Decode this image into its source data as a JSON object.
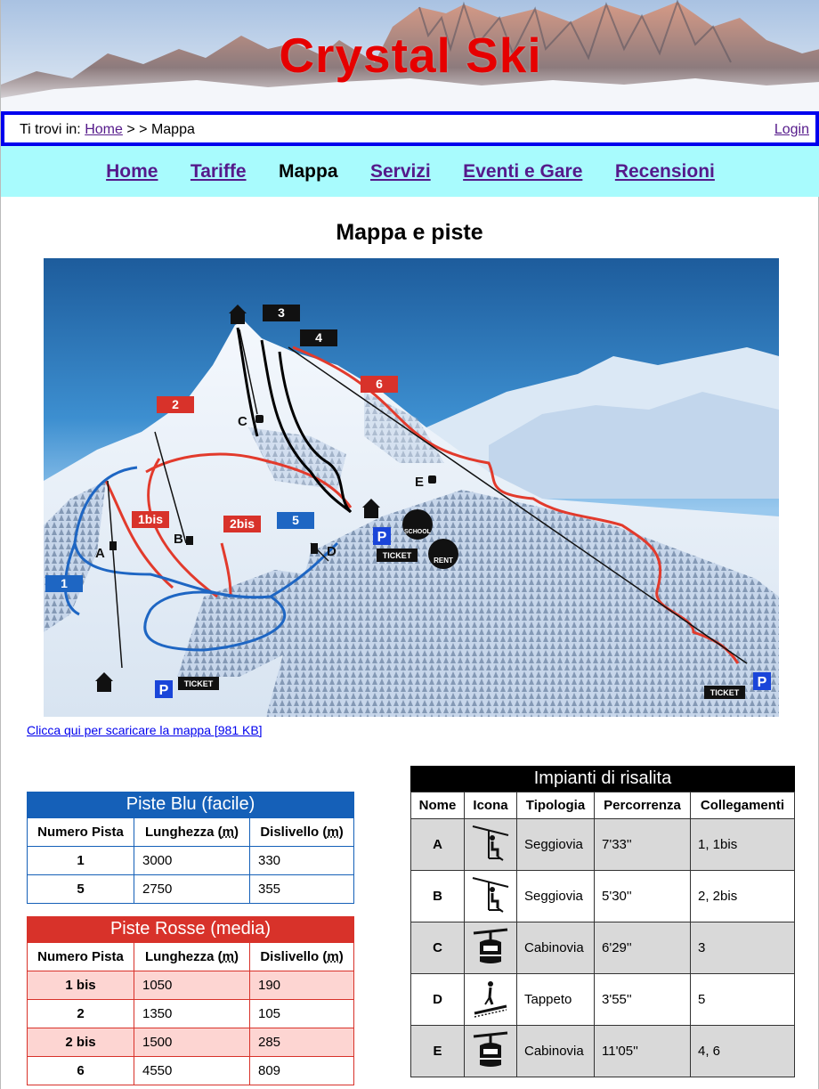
{
  "brand": "Crystal Ski",
  "breadcrumb": {
    "prefix": "Ti trovi in:",
    "home": "Home",
    "separator": "> >",
    "current": "Mappa",
    "login": "Login"
  },
  "nav": [
    {
      "label": "Home",
      "current": false
    },
    {
      "label": "Tariffe",
      "current": false
    },
    {
      "label": "Mappa",
      "current": true
    },
    {
      "label": "Servizi",
      "current": false
    },
    {
      "label": "Eventi e Gare",
      "current": false
    },
    {
      "label": "Recensioni",
      "current": false
    }
  ],
  "page_title": "Mappa e piste",
  "map": {
    "labels": {
      "p3": "3",
      "p4": "4",
      "p6": "6",
      "p2": "2",
      "p1bis": "1bis",
      "p2bis": "2bis",
      "p5": "5",
      "p1": "1",
      "la": "A",
      "lb": "B",
      "lc": "C",
      "ld": "D",
      "le": "E",
      "school": "SCHOOL",
      "rent": "RENT",
      "ticket": "TICKET",
      "parking": "P"
    }
  },
  "download_link": "Clicca qui per scaricare la mappa [981 KB]",
  "blue_table": {
    "caption": "Piste Blu (facile)",
    "headers": [
      "Numero Pista",
      "Lunghezza (",
      "m",
      ")",
      "Dislivello (",
      "m",
      ")"
    ],
    "rows": [
      [
        "1",
        "3000",
        "330"
      ],
      [
        "5",
        "2750",
        "355"
      ]
    ]
  },
  "red_table": {
    "caption": "Piste Rosse (media)",
    "headers": [
      "Numero Pista",
      "Lunghezza (",
      "m",
      ")",
      "Dislivello (",
      "m",
      ")"
    ],
    "rows": [
      [
        "1 bis",
        "1050",
        "190"
      ],
      [
        "2",
        "1350",
        "105"
      ],
      [
        "2 bis",
        "1500",
        "285"
      ],
      [
        "6",
        "4550",
        "809"
      ]
    ]
  },
  "lift_table": {
    "caption": "Impianti di risalita",
    "headers": [
      "Nome",
      "Icona",
      "Tipologia",
      "Percorrenza",
      "Collegamenti"
    ],
    "rows": [
      {
        "name": "A",
        "icon": "chairlift-icon",
        "type": "Seggiovia",
        "time": "7'33''",
        "links": "1, 1bis"
      },
      {
        "name": "B",
        "icon": "chairlift-icon",
        "type": "Seggiovia",
        "time": "5'30''",
        "links": "2, 2bis"
      },
      {
        "name": "C",
        "icon": "gondola-icon",
        "type": "Cabinovia",
        "time": "6'29''",
        "links": "3"
      },
      {
        "name": "D",
        "icon": "conveyor-icon",
        "type": "Tappeto",
        "time": "3'55''",
        "links": "5"
      },
      {
        "name": "E",
        "icon": "gondola-icon",
        "type": "Cabinovia",
        "time": "11'05''",
        "links": "4, 6"
      }
    ]
  },
  "colors": {
    "brand": "#e60000",
    "breadcrumb_border": "#0000ee",
    "nav_bg": "#a8fbfd",
    "blue_piste": "#1560b8",
    "red_piste": "#d8322a",
    "red_tint": "#fdd5d2",
    "lift_tint": "#d9d9d9"
  }
}
